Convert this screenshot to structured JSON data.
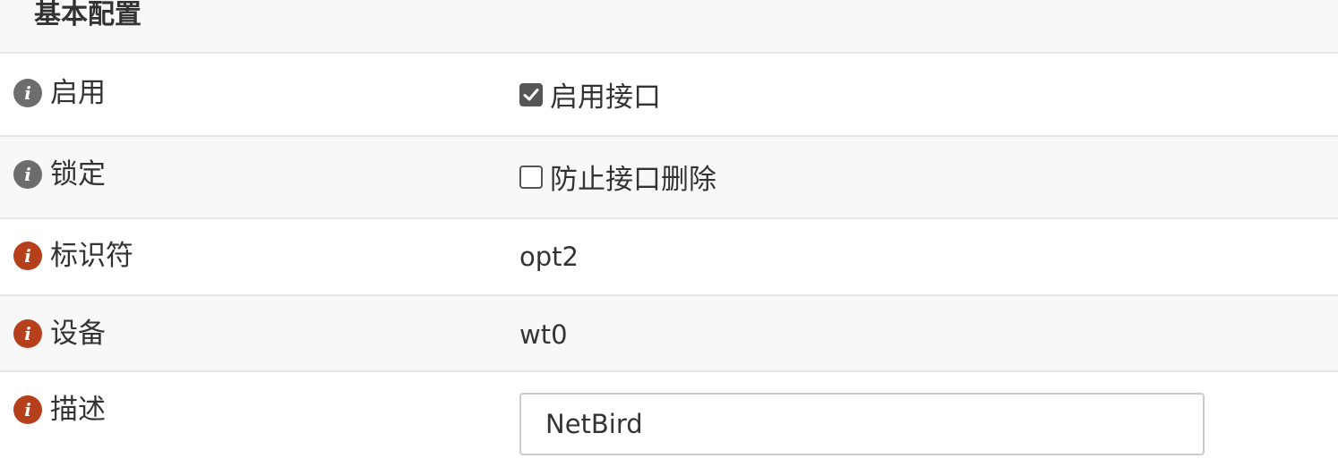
{
  "section": {
    "title": "基本配置"
  },
  "rows": {
    "enable": {
      "label": "启用",
      "checkbox_checked": true,
      "checkbox_label": "启用接口"
    },
    "lock": {
      "label": "锁定",
      "checkbox_checked": false,
      "checkbox_label": "防止接口删除"
    },
    "identifier": {
      "label": "标识符",
      "value": "opt2"
    },
    "device": {
      "label": "设备",
      "value": "wt0"
    },
    "description": {
      "label": "描述",
      "input_value": "NetBird"
    }
  },
  "colors": {
    "info_icon_gray": "#6d6d6d",
    "info_icon_red": "#b7401c",
    "row_alt_bg": "#f8f8f8",
    "border": "#e6e6e6"
  },
  "icons": {
    "info": "info-circle-icon",
    "check": "checkmark-icon"
  }
}
